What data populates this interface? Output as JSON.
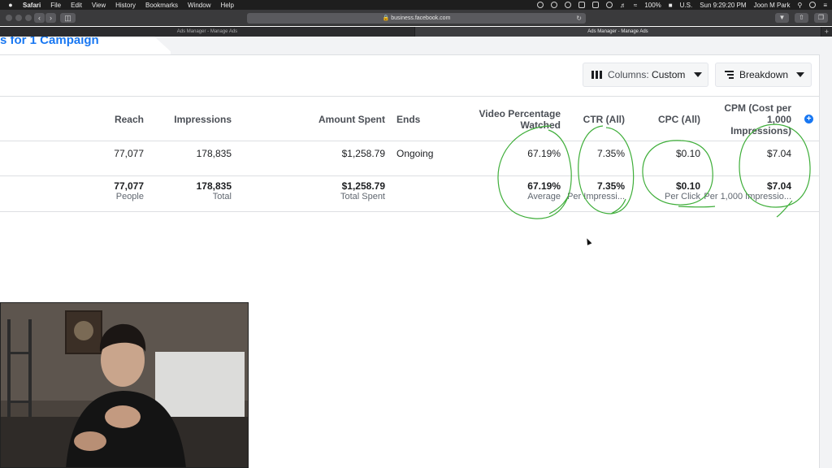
{
  "menubar": {
    "app": "Safari",
    "items": [
      "File",
      "Edit",
      "View",
      "History",
      "Bookmarks",
      "Window",
      "Help"
    ],
    "battery": "100%",
    "input_source": "U.S.",
    "clock": "Sun 9:29:20 PM",
    "user": "Joon M Park"
  },
  "browser": {
    "url": "business.facebook.com",
    "tabs": [
      {
        "label": "Ads Manager - Manage Ads",
        "active": false
      },
      {
        "label": "Ads Manager - Manage Ads",
        "active": true
      }
    ]
  },
  "page": {
    "title_fragment": "s for 1 Campaign",
    "columns_button": {
      "label": "Columns:",
      "value": "Custom"
    },
    "breakdown_button": {
      "label": "Breakdown"
    }
  },
  "table": {
    "headers": {
      "reach": "Reach",
      "impressions": "Impressions",
      "amount_spent": "Amount Spent",
      "ends": "Ends",
      "video_pct_line1": "Video Percentage",
      "video_pct_line2": "Watched",
      "ctr": "CTR (All)",
      "cpc": "CPC (All)",
      "cpm_line1": "CPM (Cost per",
      "cpm_line2": "1,000",
      "cpm_line3": "Impressions)"
    },
    "row": {
      "reach": "77,077",
      "impressions": "178,835",
      "amount_spent": "$1,258.79",
      "ends": "Ongoing",
      "video_pct": "67.19%",
      "ctr": "7.35%",
      "cpc": "$0.10",
      "cpm": "$7.04"
    },
    "totals": {
      "reach": "77,077",
      "reach_sub": "People",
      "impressions": "178,835",
      "impressions_sub": "Total",
      "amount_spent": "$1,258.79",
      "amount_spent_sub": "Total Spent",
      "video_pct": "67.19%",
      "video_pct_sub": "Average",
      "ctr": "7.35%",
      "ctr_sub": "Per Impressi...",
      "cpc": "$0.10",
      "cpc_sub": "Per Click",
      "cpm": "$7.04",
      "cpm_sub": "Per 1,000 Impressio..."
    }
  },
  "colors": {
    "brand_blue": "#1877f2",
    "annotation_green": "#3fae3a"
  }
}
